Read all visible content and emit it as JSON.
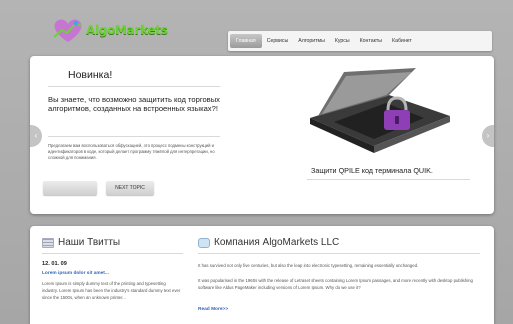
{
  "header": {
    "logo_text": "AlgoMarkets"
  },
  "nav": {
    "items": [
      "Главная",
      "Сервисы",
      "Алгоритмы",
      "Курсы",
      "Контакты",
      "Кабинет"
    ],
    "active_index": 0
  },
  "slider": {
    "title": "Новинка!",
    "question": "Вы знаете, что возможно защитить код торговых алгоритмов, созданных на встроенных языках?!",
    "description": "Предлагаем вам воспользоваться обфускацией, это процесс подмены конструкций и идентификаторов в коде, который делает программу тяжёлой для интерпретации, но сложной для понимания.",
    "button_blank": "",
    "button_next": "NEXT TOPIC",
    "caption": "Защити QPILE код терминала QUIK.",
    "prev_arrow": "‹",
    "next_arrow": "›"
  },
  "tweets": {
    "heading": "Наши Твитты",
    "date": "12. 01. 09",
    "link": "Lorem ipsum dolor sit amet...",
    "body": "Lorem Ipsum is simply dummy text of the printing and typesetting industry. Lorem Ipsum has been the industry's standard dummy text ever since the 1500s, when an unknown printer..."
  },
  "company": {
    "heading": "Компания AlgoMarkets LLC",
    "paragraph1": "It has survived not only five centuries, but also the leap into electronic typesetting, remaining essentially unchanged.",
    "paragraph2": "It was popularised in the 1960s with the release of Letraset sheets containing Lorem Ipsum passages, and more recently with desktop publishing software like Aldus PageMaker including versions of Lorem Ipsum. Why do we use it?",
    "read_more": "Read More>>"
  },
  "colors": {
    "background": "#a9a9a9",
    "panel": "#ffffff",
    "link": "#3366bb",
    "logo": "#6fd13a"
  }
}
